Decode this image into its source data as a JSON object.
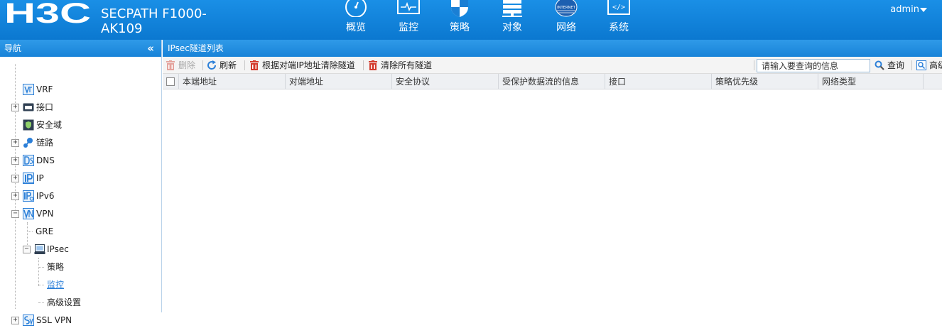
{
  "brand": {
    "logo_text": "H3C",
    "product": [
      "SECPATH F1000-",
      "AK109"
    ]
  },
  "topnav": [
    {
      "label": "概览",
      "icon": "dashboard-icon"
    },
    {
      "label": "监控",
      "icon": "monitor-icon"
    },
    {
      "label": "策略",
      "icon": "shield-icon"
    },
    {
      "label": "对象",
      "icon": "server-stack-icon"
    },
    {
      "label": "网络",
      "icon": "internet-globe-icon"
    },
    {
      "label": "系统",
      "icon": "code-icon"
    }
  ],
  "topnav_icon_text": {
    "internet": "INTERNET",
    "code": "</>"
  },
  "user": {
    "name": "admin"
  },
  "sidebar": {
    "title": "导航",
    "collapse": "«",
    "expand_sign": {
      "collapsed": "+",
      "expanded": "−"
    },
    "items": [
      {
        "label": "VRF"
      },
      {
        "label": "接口"
      },
      {
        "label": "安全域"
      },
      {
        "label": "链路"
      },
      {
        "label": "DNS"
      },
      {
        "label": "IP"
      },
      {
        "label": "IPv6"
      },
      {
        "label": "VPN"
      },
      {
        "label": "GRE"
      },
      {
        "label": "IPsec"
      },
      {
        "label": "策略"
      },
      {
        "label": "监控"
      },
      {
        "label": "高级设置"
      },
      {
        "label": "SSL VPN"
      }
    ]
  },
  "main": {
    "title": "IPsec隧道列表",
    "toolbar": {
      "delete": "删除",
      "refresh": "刷新",
      "clear_by_peer": "根据对端IP地址清除隧道",
      "clear_all": "清除所有隧道",
      "search_value": "请输入要查询的信息",
      "query": "查询",
      "advanced": "高级"
    },
    "columns": [
      "本端地址",
      "对端地址",
      "安全协议",
      "受保护数据流的信息",
      "接口",
      "策略优先级",
      "网络类型"
    ]
  },
  "colors": {
    "header_blue": "#0b78d0",
    "delete_red": "#d33a2c",
    "refresh_blue": "#2b7fd8",
    "active_link": "#2b7fd8"
  }
}
